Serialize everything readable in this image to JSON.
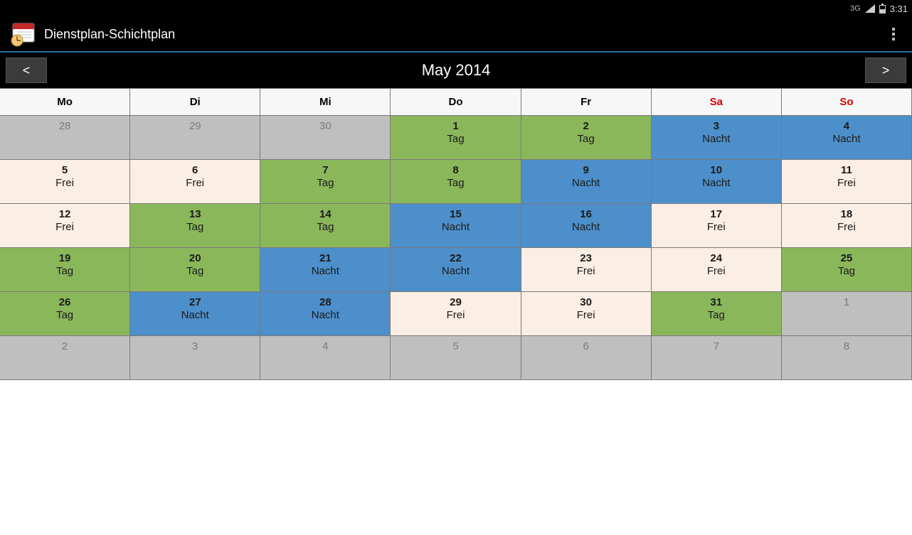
{
  "status": {
    "network": "3G",
    "time": "3:31"
  },
  "app": {
    "title": "Dienstplan-Schichtplan"
  },
  "nav": {
    "prev": "<",
    "next": ">",
    "month_label": "May 2014"
  },
  "weekdays": [
    {
      "label": "Mo",
      "weekend": false
    },
    {
      "label": "Di",
      "weekend": false
    },
    {
      "label": "Mi",
      "weekend": false
    },
    {
      "label": "Do",
      "weekend": false
    },
    {
      "label": "Fr",
      "weekend": false
    },
    {
      "label": "Sa",
      "weekend": true
    },
    {
      "label": "So",
      "weekend": true
    }
  ],
  "shift_colors": {
    "Tag": "#8bb75b",
    "Nacht": "#4d8fca",
    "Frei": "#fbeee4",
    "dim": "#bfbfbf"
  },
  "weeks": [
    [
      {
        "num": "28",
        "label": "",
        "other": true
      },
      {
        "num": "29",
        "label": "",
        "other": true
      },
      {
        "num": "30",
        "label": "",
        "other": true
      },
      {
        "num": "1",
        "label": "Tag"
      },
      {
        "num": "2",
        "label": "Tag"
      },
      {
        "num": "3",
        "label": "Nacht"
      },
      {
        "num": "4",
        "label": "Nacht"
      }
    ],
    [
      {
        "num": "5",
        "label": "Frei"
      },
      {
        "num": "6",
        "label": "Frei"
      },
      {
        "num": "7",
        "label": "Tag"
      },
      {
        "num": "8",
        "label": "Tag"
      },
      {
        "num": "9",
        "label": "Nacht"
      },
      {
        "num": "10",
        "label": "Nacht"
      },
      {
        "num": "11",
        "label": "Frei"
      }
    ],
    [
      {
        "num": "12",
        "label": "Frei"
      },
      {
        "num": "13",
        "label": "Tag"
      },
      {
        "num": "14",
        "label": "Tag"
      },
      {
        "num": "15",
        "label": "Nacht"
      },
      {
        "num": "16",
        "label": "Nacht"
      },
      {
        "num": "17",
        "label": "Frei"
      },
      {
        "num": "18",
        "label": "Frei"
      }
    ],
    [
      {
        "num": "19",
        "label": "Tag"
      },
      {
        "num": "20",
        "label": "Tag"
      },
      {
        "num": "21",
        "label": "Nacht"
      },
      {
        "num": "22",
        "label": "Nacht"
      },
      {
        "num": "23",
        "label": "Frei"
      },
      {
        "num": "24",
        "label": "Frei"
      },
      {
        "num": "25",
        "label": "Tag"
      }
    ],
    [
      {
        "num": "26",
        "label": "Tag"
      },
      {
        "num": "27",
        "label": "Nacht"
      },
      {
        "num": "28",
        "label": "Nacht"
      },
      {
        "num": "29",
        "label": "Frei"
      },
      {
        "num": "30",
        "label": "Frei"
      },
      {
        "num": "31",
        "label": "Tag"
      },
      {
        "num": "1",
        "label": "",
        "other": true
      }
    ],
    [
      {
        "num": "2",
        "label": "",
        "other": true
      },
      {
        "num": "3",
        "label": "",
        "other": true
      },
      {
        "num": "4",
        "label": "",
        "other": true
      },
      {
        "num": "5",
        "label": "",
        "other": true
      },
      {
        "num": "6",
        "label": "",
        "other": true
      },
      {
        "num": "7",
        "label": "",
        "other": true
      },
      {
        "num": "8",
        "label": "",
        "other": true
      }
    ]
  ]
}
